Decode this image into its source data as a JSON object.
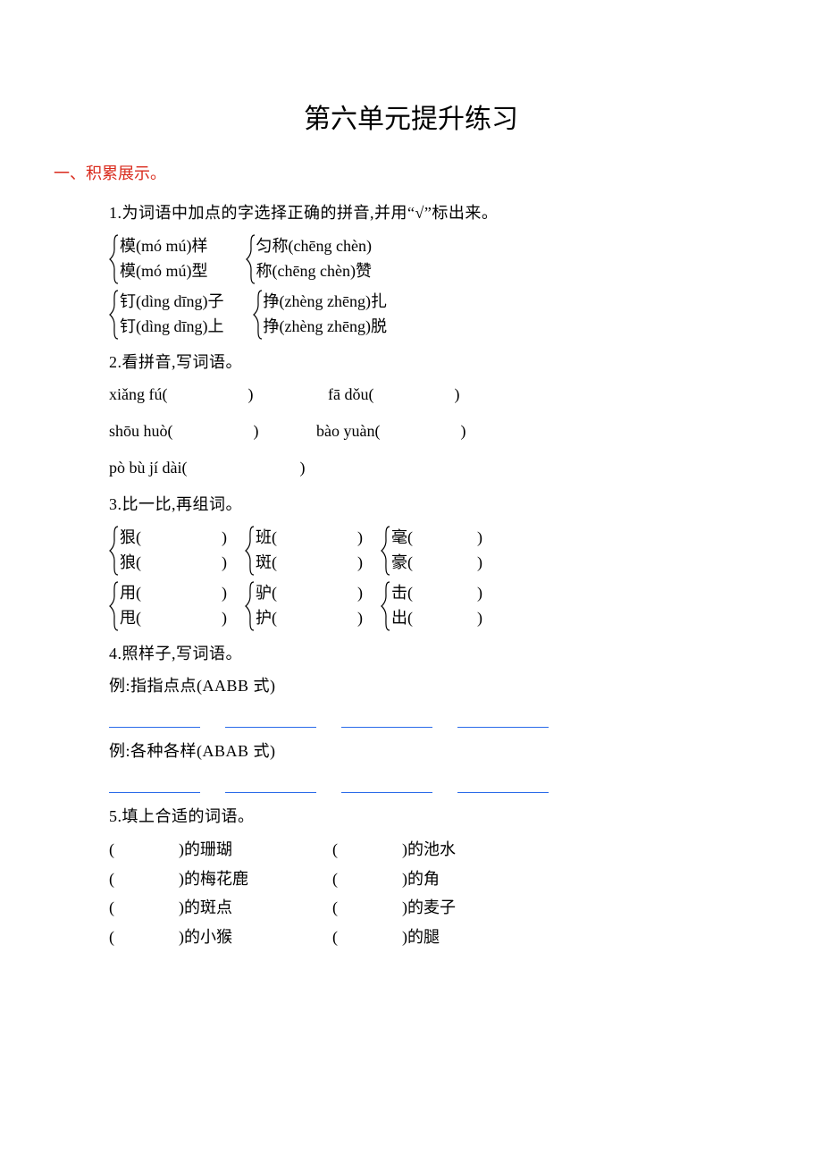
{
  "title": "第六单元提升练习",
  "section": {
    "number": "一、",
    "heading": "积累展示。"
  },
  "q1": {
    "num": "1.",
    "text": "为词语中加点的字选择正确的拼音,并用“√”标出来。",
    "r1c1a": "模(mó   mú)样",
    "r1c1b": "模(mó   mú)型",
    "r1c2a": "匀称(chēng   chèn)",
    "r1c2b": "称(chēng   chèn)赞",
    "r2c1a": "钉(dìng   dīng)子",
    "r2c1b": "钉(dìng   dīng)上",
    "r2c2a": "挣(zhèng   zhēng)扎",
    "r2c2b": "挣(zhèng   zhēng)脱"
  },
  "q2": {
    "num": "2.",
    "text": "看拼音,写词语。",
    "line1a": "xiǎng fú(　　　　　)",
    "line1b": "fā dǒu(　　　　　)",
    "line2a": "shōu huò(　　　　　)",
    "line2b": "bào yuàn(　　　　　)",
    "line3": "pò bù jí dài(　　　　　　　)"
  },
  "q3": {
    "num": "3.",
    "text": "比一比,再组词。",
    "r1c1a": "狠(　　　　　)",
    "r1c1b": "狼(　　　　　)",
    "r1c2a": "班(　　　　　)",
    "r1c2b": "斑(　　　　　)",
    "r1c3a": "毫(　　　　)",
    "r1c3b": "豪(　　　　)",
    "r2c1a": "用(　　　　　)",
    "r2c1b": "甩(　　　　　)",
    "r2c2a": "驴(　　　　　)",
    "r2c2b": "护(　　　　　)",
    "r2c3a": "击(　　　　)",
    "r2c3b": "出(　　　　)"
  },
  "q4": {
    "num": "4.",
    "text": "照样子,写词语。",
    "example1": "例:指指点点(AABB 式)",
    "example2": "例:各种各样(ABAB 式)"
  },
  "q5": {
    "num": "5.",
    "text": "填上合适的词语。",
    "l1a": "(　　　　)的珊瑚",
    "l1b": "(　　　　)的池水",
    "l2a": "(　　　　)的梅花鹿",
    "l2b": "(　　　　)的角",
    "l3a": "(　　　　)的斑点",
    "l3b": "(　　　　)的麦子",
    "l4a": "(　　　　)的小猴",
    "l4b": "(　　　　)的腿"
  }
}
